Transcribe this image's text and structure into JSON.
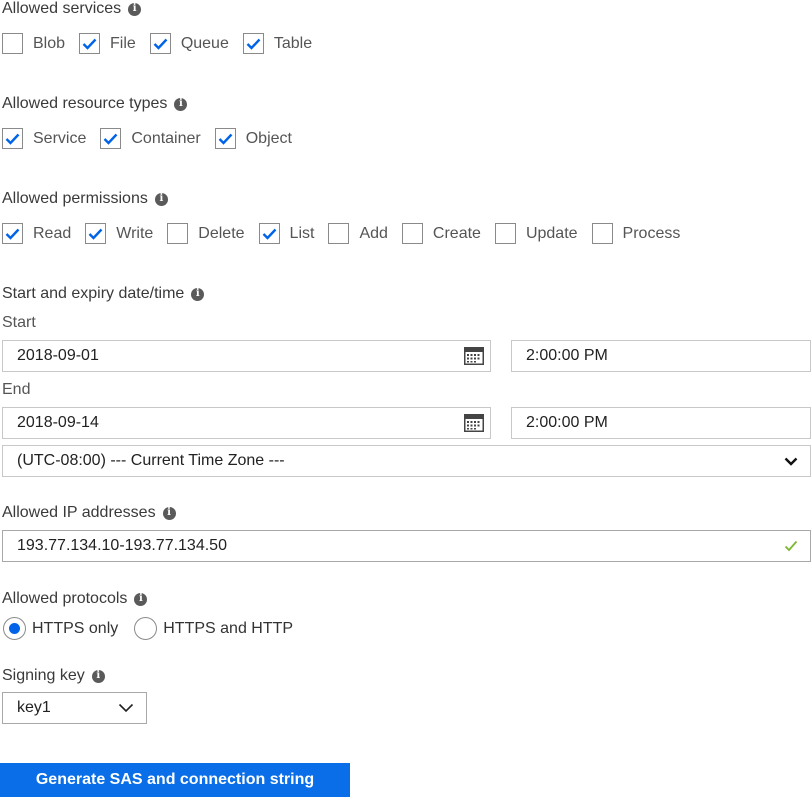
{
  "services": {
    "label": "Allowed services",
    "items": [
      {
        "label": "Blob",
        "checked": false
      },
      {
        "label": "File",
        "checked": true
      },
      {
        "label": "Queue",
        "checked": true
      },
      {
        "label": "Table",
        "checked": true
      }
    ]
  },
  "resource_types": {
    "label": "Allowed resource types",
    "items": [
      {
        "label": "Service",
        "checked": true
      },
      {
        "label": "Container",
        "checked": true
      },
      {
        "label": "Object",
        "checked": true
      }
    ]
  },
  "permissions": {
    "label": "Allowed permissions",
    "items": [
      {
        "label": "Read",
        "checked": true
      },
      {
        "label": "Write",
        "checked": true
      },
      {
        "label": "Delete",
        "checked": false
      },
      {
        "label": "List",
        "checked": true
      },
      {
        "label": "Add",
        "checked": false
      },
      {
        "label": "Create",
        "checked": false
      },
      {
        "label": "Update",
        "checked": false
      },
      {
        "label": "Process",
        "checked": false
      }
    ]
  },
  "datetime": {
    "label": "Start and expiry date/time",
    "start_label": "Start",
    "start_date": "2018-09-01",
    "start_time": "2:00:00 PM",
    "end_label": "End",
    "end_date": "2018-09-14",
    "end_time": "2:00:00 PM",
    "timezone": "(UTC-08:00) --- Current Time Zone ---"
  },
  "ip": {
    "label": "Allowed IP addresses",
    "value": "193.77.134.10-193.77.134.50",
    "valid": true
  },
  "protocols": {
    "label": "Allowed protocols",
    "options": [
      {
        "label": "HTTPS only",
        "selected": true
      },
      {
        "label": "HTTPS and HTTP",
        "selected": false
      }
    ]
  },
  "signing_key": {
    "label": "Signing key",
    "value": "key1"
  },
  "generate_button": "Generate SAS and connection string",
  "colors": {
    "accent": "#0a6ee8",
    "check": "#0063e8",
    "valid": "#7cb82f"
  }
}
